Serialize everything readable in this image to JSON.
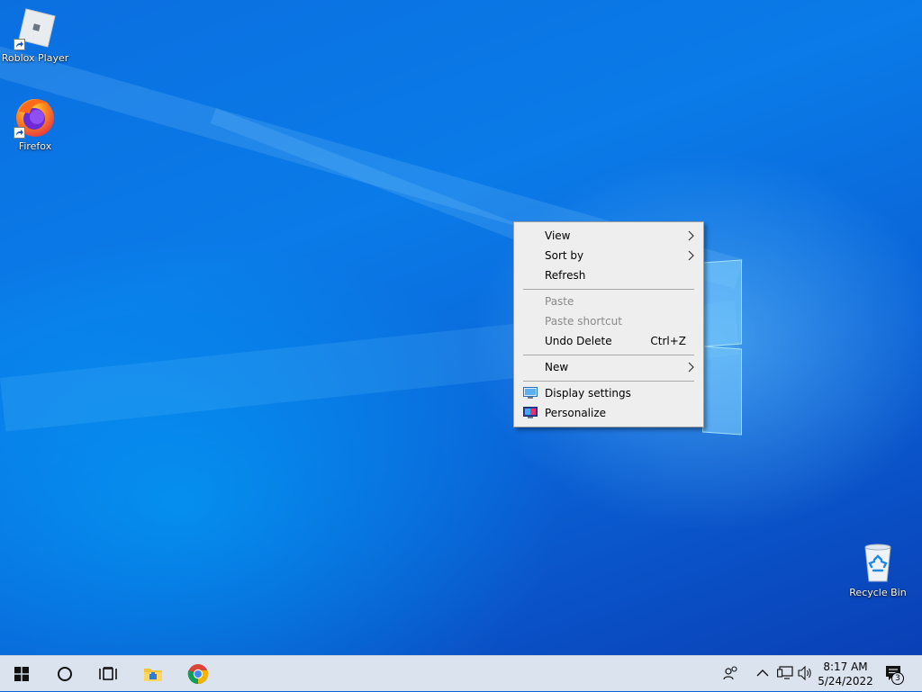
{
  "desktop": {
    "icons": [
      {
        "label": "Roblox Player",
        "icon": "roblox-icon"
      },
      {
        "label": "Firefox",
        "icon": "firefox-icon"
      },
      {
        "label": "Recycle Bin",
        "icon": "recycle-bin-icon"
      }
    ]
  },
  "context_menu": {
    "items": [
      {
        "label": "View",
        "submenu": true,
        "enabled": true
      },
      {
        "label": "Sort by",
        "submenu": true,
        "enabled": true
      },
      {
        "label": "Refresh",
        "enabled": true
      },
      {
        "label": "Paste",
        "enabled": false
      },
      {
        "label": "Paste shortcut",
        "enabled": false
      },
      {
        "label": "Undo Delete",
        "shortcut": "Ctrl+Z",
        "enabled": true
      },
      {
        "label": "New",
        "submenu": true,
        "enabled": true
      },
      {
        "label": "Display settings",
        "icon": "display-icon",
        "enabled": true
      },
      {
        "label": "Personalize",
        "icon": "personalize-icon",
        "enabled": true
      }
    ]
  },
  "taskbar": {
    "pinned": [
      {
        "name": "start-icon"
      },
      {
        "name": "search-circle-icon"
      },
      {
        "name": "task-view-icon"
      },
      {
        "name": "file-explorer-icon"
      },
      {
        "name": "chrome-icon"
      }
    ],
    "tray": {
      "icons": [
        "people-icon",
        "chevron-up-icon",
        "network-icon",
        "volume-icon"
      ],
      "time": "8:17 AM",
      "date": "5/24/2022",
      "notification_count": "3"
    }
  },
  "colors": {
    "desktop_blue": "#0a63d8",
    "taskbar": "#dbe3ef",
    "menu_bg": "#eeeeee"
  }
}
